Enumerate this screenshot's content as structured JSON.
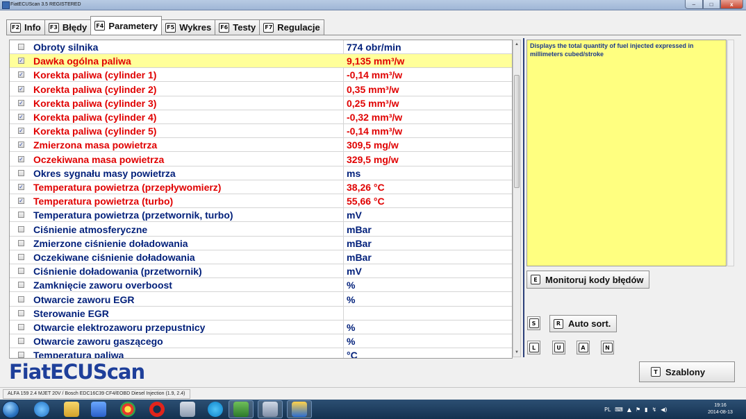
{
  "window": {
    "title": "FiatECUScan 3.5 REGISTERED",
    "minimize": "–",
    "maximize": "□",
    "close": "x"
  },
  "tabs": [
    {
      "key": "F2",
      "label": "Info"
    },
    {
      "key": "F3",
      "label": "Błędy"
    },
    {
      "key": "F4",
      "label": "Parametery"
    },
    {
      "key": "F5",
      "label": "Wykres"
    },
    {
      "key": "F6",
      "label": "Testy"
    },
    {
      "key": "F7",
      "label": "Regulacje"
    }
  ],
  "active_tab": "Parametery",
  "parameters": [
    {
      "name": "Obroty silnika",
      "value": "774 obr/min",
      "checked": false,
      "color": "blue"
    },
    {
      "name": "Dawka ogólna paliwa",
      "value": "9,135 mm³/w",
      "checked": true,
      "color": "red",
      "selected": true
    },
    {
      "name": "Korekta paliwa (cylinder 1)",
      "value": "-0,14 mm³/w",
      "checked": true,
      "color": "red"
    },
    {
      "name": "Korekta paliwa (cylinder 2)",
      "value": "0,35 mm³/w",
      "checked": true,
      "color": "red"
    },
    {
      "name": "Korekta paliwa (cylinder 3)",
      "value": "0,25 mm³/w",
      "checked": true,
      "color": "red"
    },
    {
      "name": "Korekta paliwa (cylinder 4)",
      "value": "-0,32 mm³/w",
      "checked": true,
      "color": "red"
    },
    {
      "name": "Korekta paliwa (cylinder 5)",
      "value": "-0,14 mm³/w",
      "checked": true,
      "color": "red"
    },
    {
      "name": "Zmierzona masa powietrza",
      "value": "309,5 mg/w",
      "checked": true,
      "color": "red"
    },
    {
      "name": "Oczekiwana masa powietrza",
      "value": "329,5 mg/w",
      "checked": true,
      "color": "red"
    },
    {
      "name": "Okres sygnału masy powietrza",
      "value": "ms",
      "checked": false,
      "color": "blue"
    },
    {
      "name": "Temperatura powietrza (przepływomierz)",
      "value": "38,26 °C",
      "checked": true,
      "color": "red"
    },
    {
      "name": "Temperatura powietrza (turbo)",
      "value": "55,66 °C",
      "checked": true,
      "color": "red"
    },
    {
      "name": "Temperatura powietrza (przetwornik, turbo)",
      "value": "mV",
      "checked": false,
      "color": "blue"
    },
    {
      "name": "Ciśnienie atmosferyczne",
      "value": "mBar",
      "checked": false,
      "color": "blue"
    },
    {
      "name": "Zmierzone ciśnienie doładowania",
      "value": "mBar",
      "checked": false,
      "color": "blue"
    },
    {
      "name": "Oczekiwane ciśnienie doładowania",
      "value": "mBar",
      "checked": false,
      "color": "blue"
    },
    {
      "name": "Ciśnienie doładowania (przetwornik)",
      "value": "mV",
      "checked": false,
      "color": "blue"
    },
    {
      "name": "Zamknięcie zaworu overboost",
      "value": "%",
      "checked": false,
      "color": "blue"
    },
    {
      "name": "Otwarcie zaworu EGR",
      "value": "%",
      "checked": false,
      "color": "blue"
    },
    {
      "name": "Sterowanie EGR",
      "value": "",
      "checked": false,
      "color": "blue"
    },
    {
      "name": "Otwarcie elektrozaworu przepustnicy",
      "value": "%",
      "checked": false,
      "color": "blue"
    },
    {
      "name": "Otwarcie zaworu gaszącego",
      "value": "%",
      "checked": false,
      "color": "blue"
    },
    {
      "name": "Temperatura paliwa",
      "value": "°C",
      "checked": false,
      "color": "blue"
    }
  ],
  "description": "Displays the total quantity of fuel injected expressed in millimeters cubed/stroke",
  "buttons": {
    "monitor": {
      "key": "E",
      "label": "Monitoruj kody błędów"
    },
    "s": {
      "key": "S"
    },
    "auto_sort": {
      "key": "R",
      "label": "Auto sort."
    },
    "l": {
      "key": "L"
    },
    "u": {
      "key": "U"
    },
    "a": {
      "key": "A"
    },
    "n": {
      "key": "N"
    },
    "templates": {
      "key": "T",
      "label": "Szablony"
    }
  },
  "logo": "FiatECUScan",
  "status": "ALFA 159 2.4 MJET 20V / Bosch EDC16C39 CF4/EOBD Diesel Injection (1.9, 2.4)",
  "taskbar": {
    "tray_lang": "PL",
    "clock_time": "19:16",
    "clock_date": "2014-08-13"
  },
  "colors": {
    "red": "#e00000",
    "blue": "#001f7a",
    "selected_row": "#ffff9a",
    "description_bg": "#ffff80"
  }
}
